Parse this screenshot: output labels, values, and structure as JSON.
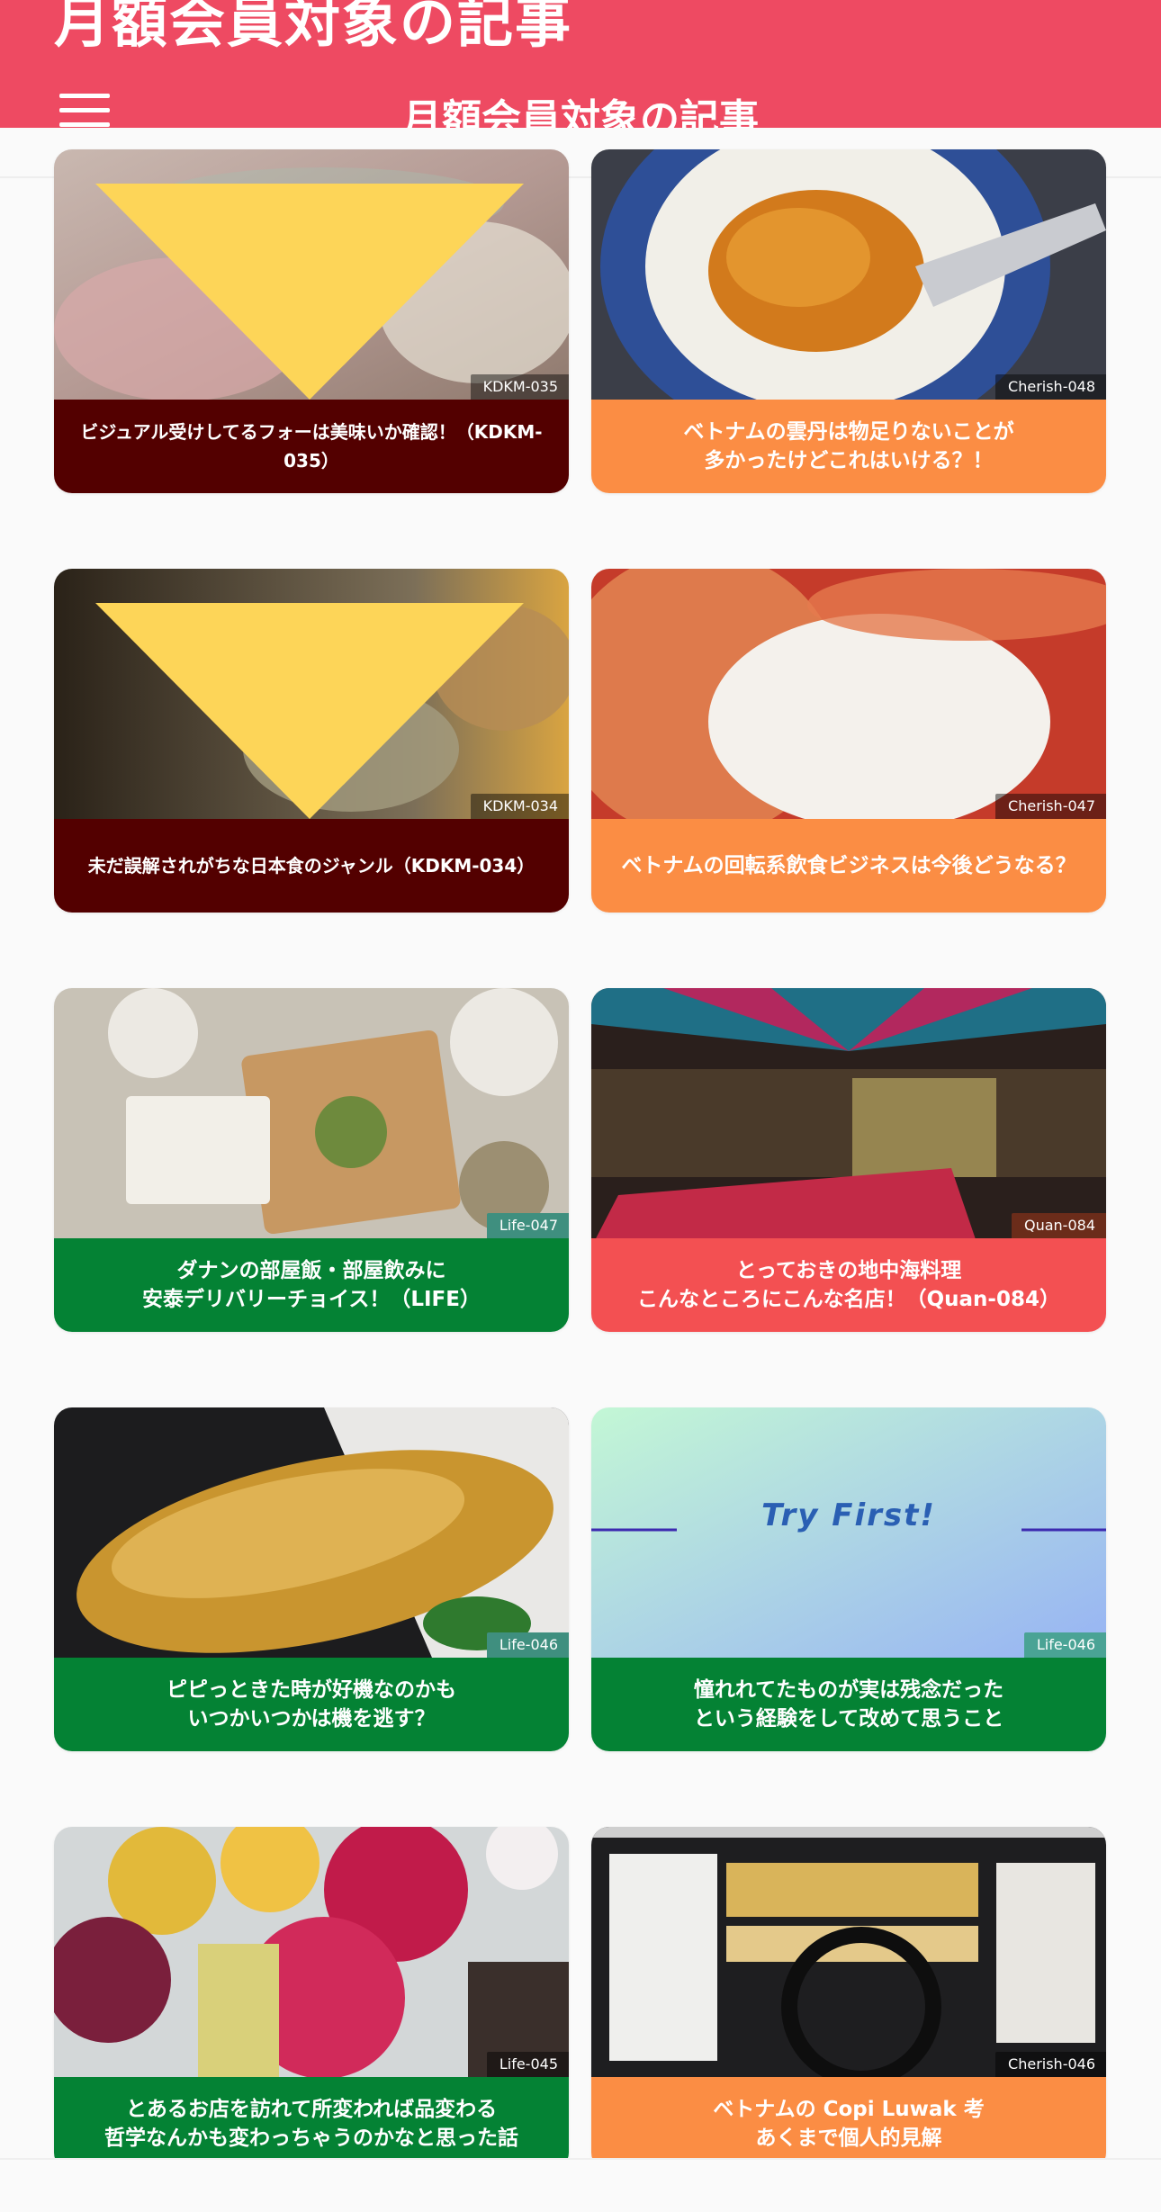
{
  "header": {
    "ghost_title": "月額会員対象の記事",
    "title": "月額会員対象の記事",
    "background": "#ee4a62",
    "menu_icon": "hamburger-menu-icon"
  },
  "colors": {
    "maroon": "#530000",
    "orange": "#fb8d44",
    "green": "#048234",
    "red": "#f35052",
    "lock_triangle": "#fdd558"
  },
  "cards": [
    {
      "code": "KDKM-035",
      "title": "ビジュアル受けしてるフォーは美味いか確認！（KDKM-035）",
      "label_color": "maroon",
      "locked": true
    },
    {
      "code": "Cherish-048",
      "title": "ベトナムの雲丹は物足りないことが\n多かったけどこれはいける？！",
      "label_color": "orange",
      "locked": false
    },
    {
      "code": "KDKM-034",
      "title": "未だ誤解されがちな日本食のジャンル（KDKM-034）",
      "label_color": "maroon",
      "locked": true
    },
    {
      "code": "Cherish-047",
      "title": "ベトナムの回転系飲食ビジネスは今後どうなる？",
      "label_color": "orange",
      "locked": false
    },
    {
      "code": "Life-047",
      "title": "ダナンの部屋飯・部屋飲みに\n安泰デリバリーチョイス！（LIFE）",
      "label_color": "green",
      "locked": false
    },
    {
      "code": "Quan-084",
      "title": "とっておきの地中海料理\nこんなところにこんな名店！（Quan-084）",
      "label_color": "red",
      "locked": false
    },
    {
      "code": "Life-046",
      "title": "ピピっときた時が好機なのかも\nいつかいつかは機を逃す？",
      "label_color": "green",
      "locked": false
    },
    {
      "code": "Life-046",
      "title": "憧れれてたものが実は残念だった\nという経験をして改めて思うこと",
      "label_color": "green",
      "locked": false,
      "image_text": "Try First!"
    },
    {
      "code": "Life-045",
      "title": "とあるお店を訪れて所変われば品変わる\n哲学なんかも変わっちゃうのかなと思った話",
      "label_color": "green",
      "locked": false
    },
    {
      "code": "Cherish-046",
      "title": "ベトナムの Copi Luwak 考\nあくまで個人的見解",
      "label_color": "orange",
      "locked": false
    }
  ]
}
